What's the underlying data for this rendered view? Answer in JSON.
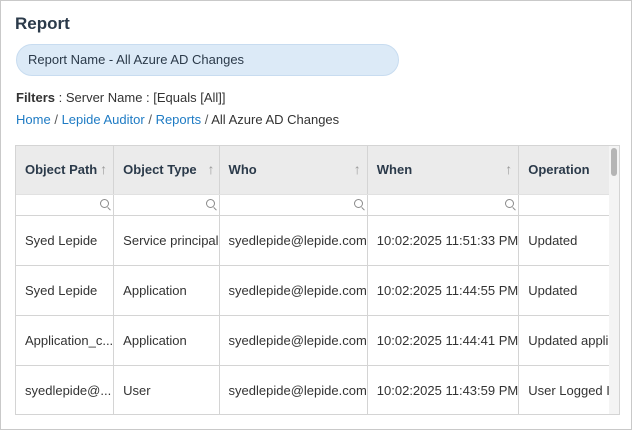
{
  "page": {
    "title": "Report"
  },
  "report_name": "Report Name - All Azure AD Changes",
  "filters": {
    "label": "Filters",
    "value": " : Server Name : [Equals [All]]"
  },
  "breadcrumb": {
    "home": "Home",
    "auditor": "Lepide Auditor",
    "reports": "Reports",
    "current": "All Azure AD Changes",
    "separator": "/"
  },
  "table": {
    "columns": [
      {
        "label": "Object Path"
      },
      {
        "label": "Object Type"
      },
      {
        "label": "Who"
      },
      {
        "label": "When"
      },
      {
        "label": "Operation"
      }
    ],
    "sort_arrow": "↑",
    "rows": [
      {
        "object_path": "Syed Lepide",
        "object_type": "Service principal",
        "who": "syedlepide@lepide.com",
        "when": "10:02:2025 11:51:33 PM",
        "operation": "Updated"
      },
      {
        "object_path": "Syed Lepide",
        "object_type": "Application",
        "who": "syedlepide@lepide.com",
        "when": "10:02:2025 11:44:55 PM",
        "operation": "Updated"
      },
      {
        "object_path": "Application_c...",
        "object_type": "Application",
        "who": "syedlepide@lepide.com",
        "when": "10:02:2025 11:44:41 PM",
        "operation": "Updated application"
      },
      {
        "object_path": "syedlepide@...",
        "object_type": "User",
        "who": "syedlepide@lepide.com",
        "when": "10:02:2025 11:43:59 PM",
        "operation": "User Logged In"
      }
    ]
  },
  "icons": {
    "column_filter": "search-icon",
    "sort": "sort-ascending-icon"
  }
}
